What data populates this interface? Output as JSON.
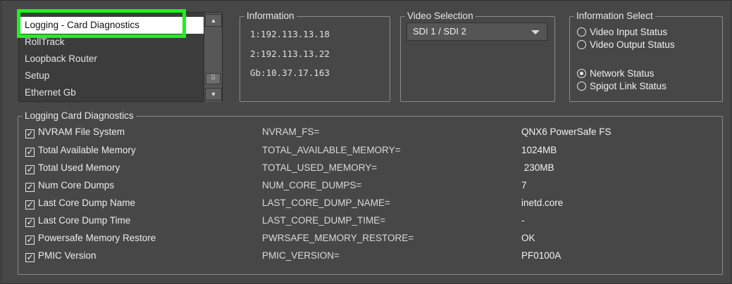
{
  "menu": {
    "items": [
      {
        "label": "Logging - Card Diagnostics",
        "selected": true
      },
      {
        "label": "RollTrack",
        "selected": false
      },
      {
        "label": "Loopback Router",
        "selected": false
      },
      {
        "label": "Setup",
        "selected": false
      },
      {
        "label": "Ethernet Gb",
        "selected": false
      }
    ]
  },
  "information": {
    "legend": "Information",
    "lines": [
      "1:192.113.13.18",
      "2:192.113.13.22",
      "Gb:10.37.17.163"
    ]
  },
  "video_selection": {
    "legend": "Video Selection",
    "selected": "SDI 1 / SDI 2"
  },
  "information_select": {
    "legend": "Information Select",
    "options": [
      {
        "label": "Video Input Status",
        "checked": false
      },
      {
        "label": "Video Output Status",
        "checked": false
      },
      {
        "label": "Network Status",
        "checked": true
      },
      {
        "label": "Spigot Link Status",
        "checked": false
      }
    ]
  },
  "diagnostics": {
    "legend": "Logging Card Diagnostics",
    "rows": [
      {
        "label": "NVRAM File System",
        "key": "NVRAM_FS=",
        "value": "QNX6 PowerSafe FS",
        "checked": true
      },
      {
        "label": "Total Available Memory",
        "key": "TOTAL_AVAILABLE_MEMORY=",
        "value": "1024MB",
        "checked": true
      },
      {
        "label": "Total Used Memory",
        "key": "TOTAL_USED_MEMORY=",
        "value": " 230MB",
        "checked": true
      },
      {
        "label": "Num Core Dumps",
        "key": "NUM_CORE_DUMPS=",
        "value": "7",
        "checked": true
      },
      {
        "label": "Last Core Dump Name",
        "key": "LAST_CORE_DUMP_NAME=",
        "value": "inetd.core",
        "checked": true
      },
      {
        "label": "Last Core Dump Time",
        "key": "LAST_CORE_DUMP_TIME=",
        "value": "-",
        "checked": true
      },
      {
        "label": "Powersafe Memory Restore",
        "key": "PWRSAFE_MEMORY_RESTORE=",
        "value": "OK",
        "checked": true
      },
      {
        "label": "PMIC Version",
        "key": "PMIC_VERSION=",
        "value": "PF0100A",
        "checked": true
      }
    ]
  },
  "colors": {
    "highlight": "#1cf21c",
    "background": "#474747"
  }
}
